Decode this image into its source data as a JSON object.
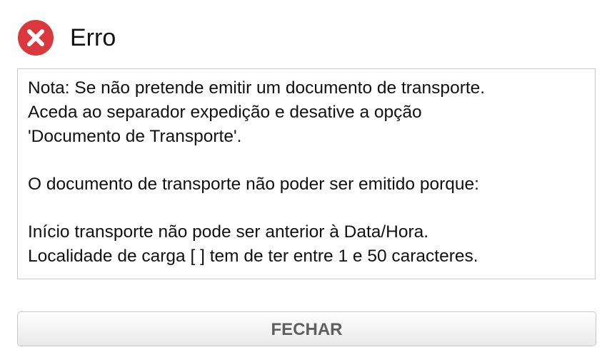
{
  "dialog": {
    "title": "Erro",
    "icon": "error-circle-x-icon",
    "accent_color": "#d9383d",
    "message_lines": [
      "Nota: Se não pretende emitir um documento de transporte.",
      "Aceda ao separador expedição e desative a opção",
      "'Documento de Transporte'.",
      "",
      "O documento de transporte não poder ser emitido porque:",
      "",
      "Início transporte não pode ser anterior à Data/Hora.",
      "Localidade de carga [  ] tem de ter entre 1 e 50 caracteres."
    ],
    "close_label": "FECHAR"
  }
}
